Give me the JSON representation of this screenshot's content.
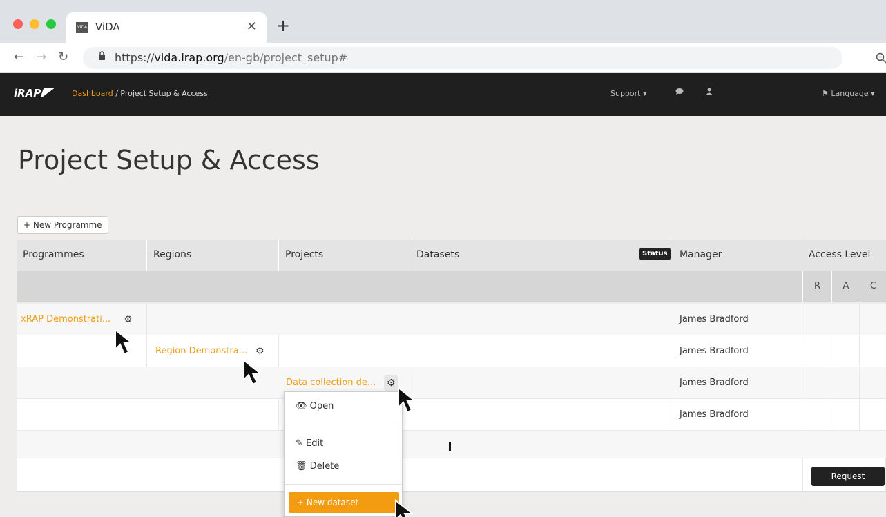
{
  "browser": {
    "tab_title": "ViDA",
    "favicon_text": "ViDA",
    "url_scheme": "https://",
    "url_host": "vida.irap.org",
    "url_path": "/en-gb/project_setup#"
  },
  "app": {
    "logo": "iRAP",
    "breadcrumb": {
      "home": "Dashboard",
      "separator": "/",
      "current": "Project Setup & Access"
    },
    "nav": {
      "support": "Support ▾",
      "language": "Language ▾"
    }
  },
  "page": {
    "title": "Project Setup & Access",
    "new_programme_label": "+ New Programme"
  },
  "table": {
    "headers": {
      "programmes": "Programmes",
      "regions": "Regions",
      "projects": "Projects",
      "datasets": "Datasets",
      "status": "Status",
      "manager": "Manager",
      "access_level": "Access Level"
    },
    "access_columns": [
      "R",
      "A",
      "C"
    ],
    "rows": [
      {
        "programme": "xRAP Demonstrati...",
        "manager": "James Bradford"
      },
      {
        "region": "Region Demonstra...",
        "manager": "James Bradford"
      },
      {
        "project": "Data collection de...",
        "manager": "James Bradford"
      },
      {
        "manager": "James Bradford"
      }
    ],
    "request_label": "Request"
  },
  "dropdown": {
    "open": "Open",
    "edit": "Edit",
    "delete": "Delete",
    "new_dataset": "+ New dataset"
  },
  "colors": {
    "accent": "#f39c12",
    "appbar": "#1f1f1f"
  }
}
